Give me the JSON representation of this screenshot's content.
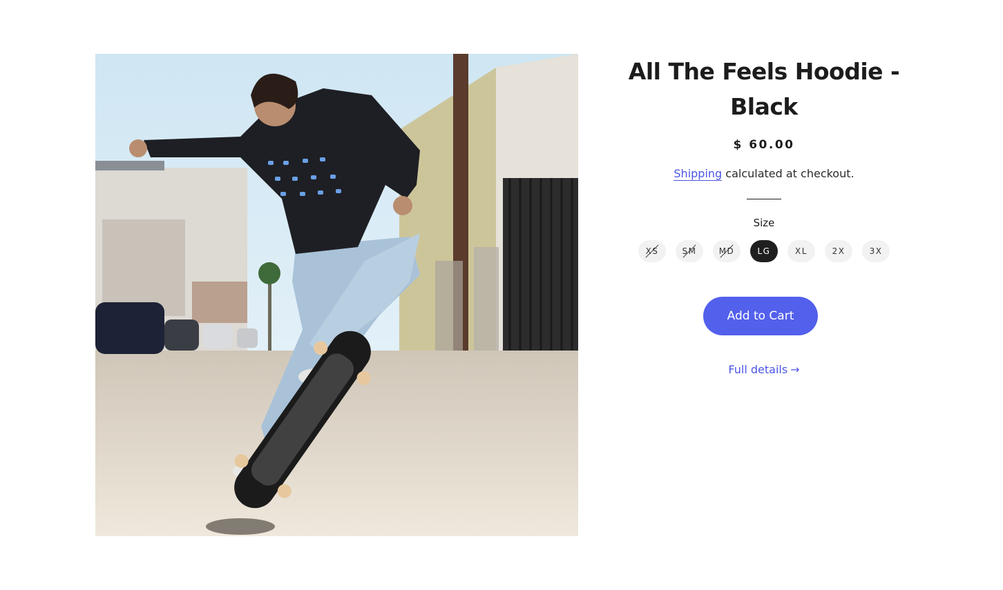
{
  "product": {
    "title": "All The Feels Hoodie - Black",
    "price": "$ 60.00",
    "image_alt": "Skateboarder wearing the All The Feels Hoodie"
  },
  "shipping": {
    "link_label": "Shipping",
    "suffix": " calculated at checkout."
  },
  "size_selector": {
    "label": "Size",
    "options": [
      {
        "label": "XS",
        "available": false,
        "selected": false
      },
      {
        "label": "SM",
        "available": false,
        "selected": false
      },
      {
        "label": "MD",
        "available": false,
        "selected": false
      },
      {
        "label": "LG",
        "available": true,
        "selected": true
      },
      {
        "label": "XL",
        "available": true,
        "selected": false
      },
      {
        "label": "2X",
        "available": true,
        "selected": false
      },
      {
        "label": "3X",
        "available": true,
        "selected": false
      }
    ]
  },
  "actions": {
    "add_to_cart_label": "Add to Cart",
    "full_details_label": "Full details",
    "full_details_arrow": "→"
  },
  "colors": {
    "accent": "#5360ec",
    "link": "#4b55e6",
    "text": "#1c1c1c",
    "selected_pill": "#1f1f1f",
    "pill_bg": "#f2f2f2"
  }
}
